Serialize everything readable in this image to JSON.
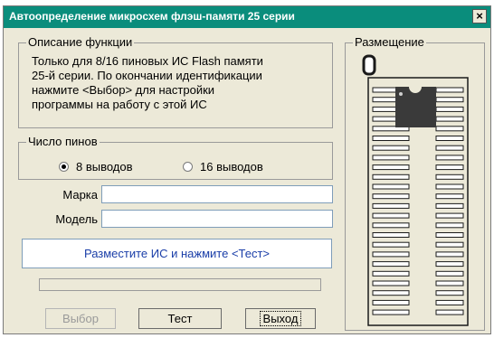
{
  "window": {
    "title": "Автоопределение микросхем флэш-памяти 25 серии",
    "close_glyph": "×"
  },
  "description": {
    "legend": "Описание функции",
    "lines": [
      "Только для 8/16 пиновых ИС Flash памяти",
      "25-й серии. По окончании идентификации",
      "нажмите <Выбор> для настройки",
      "программы на работу с этой ИС"
    ]
  },
  "pins": {
    "legend": "Число пинов",
    "option_8": "8 выводов",
    "option_16": "16 выводов",
    "selected": "8 выводов"
  },
  "fields": {
    "mark_label": "Марка",
    "mark_value": "",
    "model_label": "Модель",
    "model_value": ""
  },
  "status": {
    "text": "Разместите ИС и нажмите <Тест>",
    "text_color": "#1a3ea8"
  },
  "progress": {
    "value": 0
  },
  "buttons": {
    "select": "Выбор",
    "test": "Тест",
    "exit": "Выход"
  },
  "placement": {
    "legend": "Размещение"
  },
  "colors": {
    "title_bar": "#0a8d7c",
    "chip": "#3a3a3a",
    "socket": "#1a1a1a"
  }
}
